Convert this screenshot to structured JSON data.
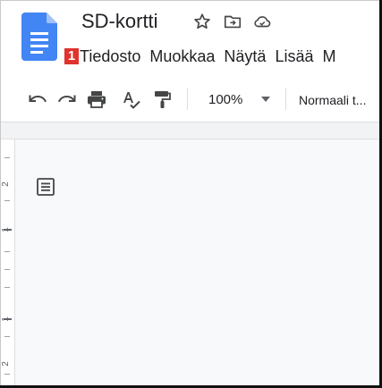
{
  "document": {
    "title": "SD-kortti",
    "icons": {
      "logo": "google-docs-logo",
      "star": "star-icon",
      "move": "folder-move-icon",
      "saved": "cloud-saved-icon"
    }
  },
  "menubar": {
    "annotation_number": "1",
    "items": [
      "Tiedosto",
      "Muokkaa",
      "Näytä",
      "Lisää",
      "M"
    ]
  },
  "toolbar": {
    "icons": [
      "undo-icon",
      "redo-icon",
      "print-icon",
      "spellcheck-icon",
      "paint-format-icon"
    ],
    "zoom": "100%",
    "style": "Normaali t..."
  },
  "ruler": {
    "labels": [
      "2",
      "1",
      "1",
      "2"
    ]
  },
  "sidebar": {
    "outline_icon": "document-outline-icon"
  },
  "colors": {
    "docs_blue": "#4285f4",
    "badge_red": "#e0322f",
    "canvas": "#f8f9fa"
  }
}
